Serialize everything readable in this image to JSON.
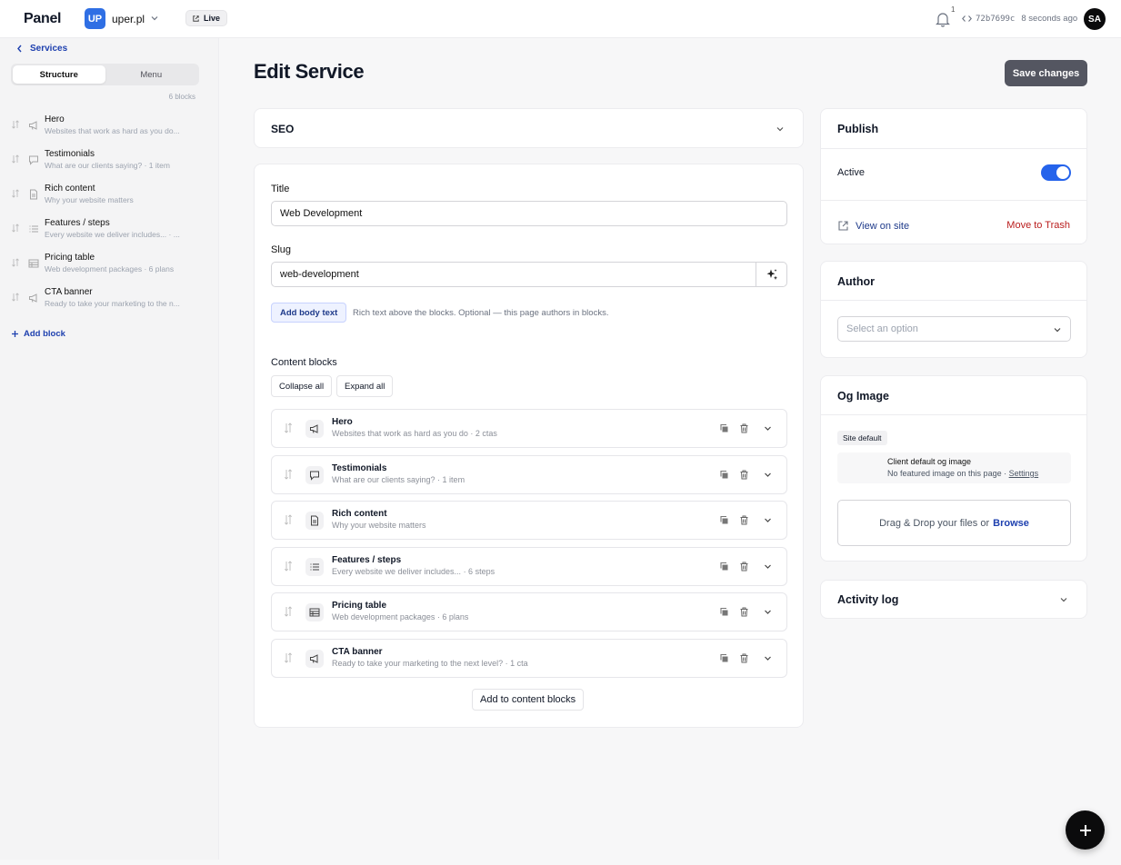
{
  "topbar": {
    "brand": "Panel",
    "site_initials": "UP",
    "site_name": "uper.pl",
    "live_label": "Live",
    "notification_count": "1",
    "commit_hash": "72b7699c",
    "last_saved": "8 seconds ago",
    "user_initials": "SA"
  },
  "sidebar": {
    "back_label": "Services",
    "tabs": [
      "Structure",
      "Menu"
    ],
    "active_tab": "Structure",
    "block_count": "6 blocks",
    "items": [
      {
        "name": "Hero",
        "sub": "Websites that work as hard as you do...",
        "icon": "megaphone-icon"
      },
      {
        "name": "Testimonials",
        "sub": "What are our clients saying? · 1 item",
        "icon": "chat-bubble-icon"
      },
      {
        "name": "Rich content",
        "sub": "Why your website matters",
        "icon": "document-icon"
      },
      {
        "name": "Features / steps",
        "sub": "Every website we deliver includes... · ...",
        "icon": "list-icon"
      },
      {
        "name": "Pricing table",
        "sub": "Web development packages · 6 plans",
        "icon": "table-icon"
      },
      {
        "name": "CTA banner",
        "sub": "Ready to take your marketing to the n...",
        "icon": "megaphone-icon"
      }
    ],
    "add_block_label": "Add block"
  },
  "main": {
    "page_title": "Edit Service",
    "save_label": "Save changes",
    "seo_label": "SEO",
    "title_label": "Title",
    "title_value": "Web Development",
    "slug_label": "Slug",
    "slug_value": "web-development",
    "add_body_text_label": "Add body text",
    "body_hint": "Rich text above the blocks. Optional — this page authors in blocks.",
    "content_blocks_label": "Content blocks",
    "collapse_all_label": "Collapse all",
    "expand_all_label": "Expand all",
    "blocks": [
      {
        "name": "Hero",
        "sub": "Websites that work as hard as you do · 2 ctas",
        "icon": "megaphone-icon"
      },
      {
        "name": "Testimonials",
        "sub": "What are our clients saying? · 1 item",
        "icon": "chat-bubble-icon"
      },
      {
        "name": "Rich content",
        "sub": "Why your website matters",
        "icon": "document-icon"
      },
      {
        "name": "Features / steps",
        "sub": "Every website we deliver includes... · 6 steps",
        "icon": "list-icon"
      },
      {
        "name": "Pricing table",
        "sub": "Web development packages · 6 plans",
        "icon": "table-icon"
      },
      {
        "name": "CTA banner",
        "sub": "Ready to take your marketing to the next level? · 1 cta",
        "icon": "megaphone-icon"
      }
    ],
    "add_to_blocks_label": "Add to content blocks"
  },
  "publish": {
    "title": "Publish",
    "active_label": "Active",
    "active_on": true,
    "view_on_site_label": "View on site",
    "move_to_trash_label": "Move to Trash"
  },
  "author": {
    "title": "Author",
    "select_placeholder": "Select an option"
  },
  "og_image": {
    "title": "Og Image",
    "chip_label": "Site default",
    "info_line1": "Client default og image",
    "info_line2": "No featured image on this page ·",
    "settings_link": "Settings",
    "drop_text": "Drag & Drop your files or",
    "browse_label": "Browse"
  },
  "activity": {
    "title": "Activity log"
  },
  "colors": {
    "accent": "#2563eb",
    "link": "#1e40af",
    "danger": "#b91c1c",
    "save_button": "#545661",
    "site_badge": "#2f6fe4"
  }
}
